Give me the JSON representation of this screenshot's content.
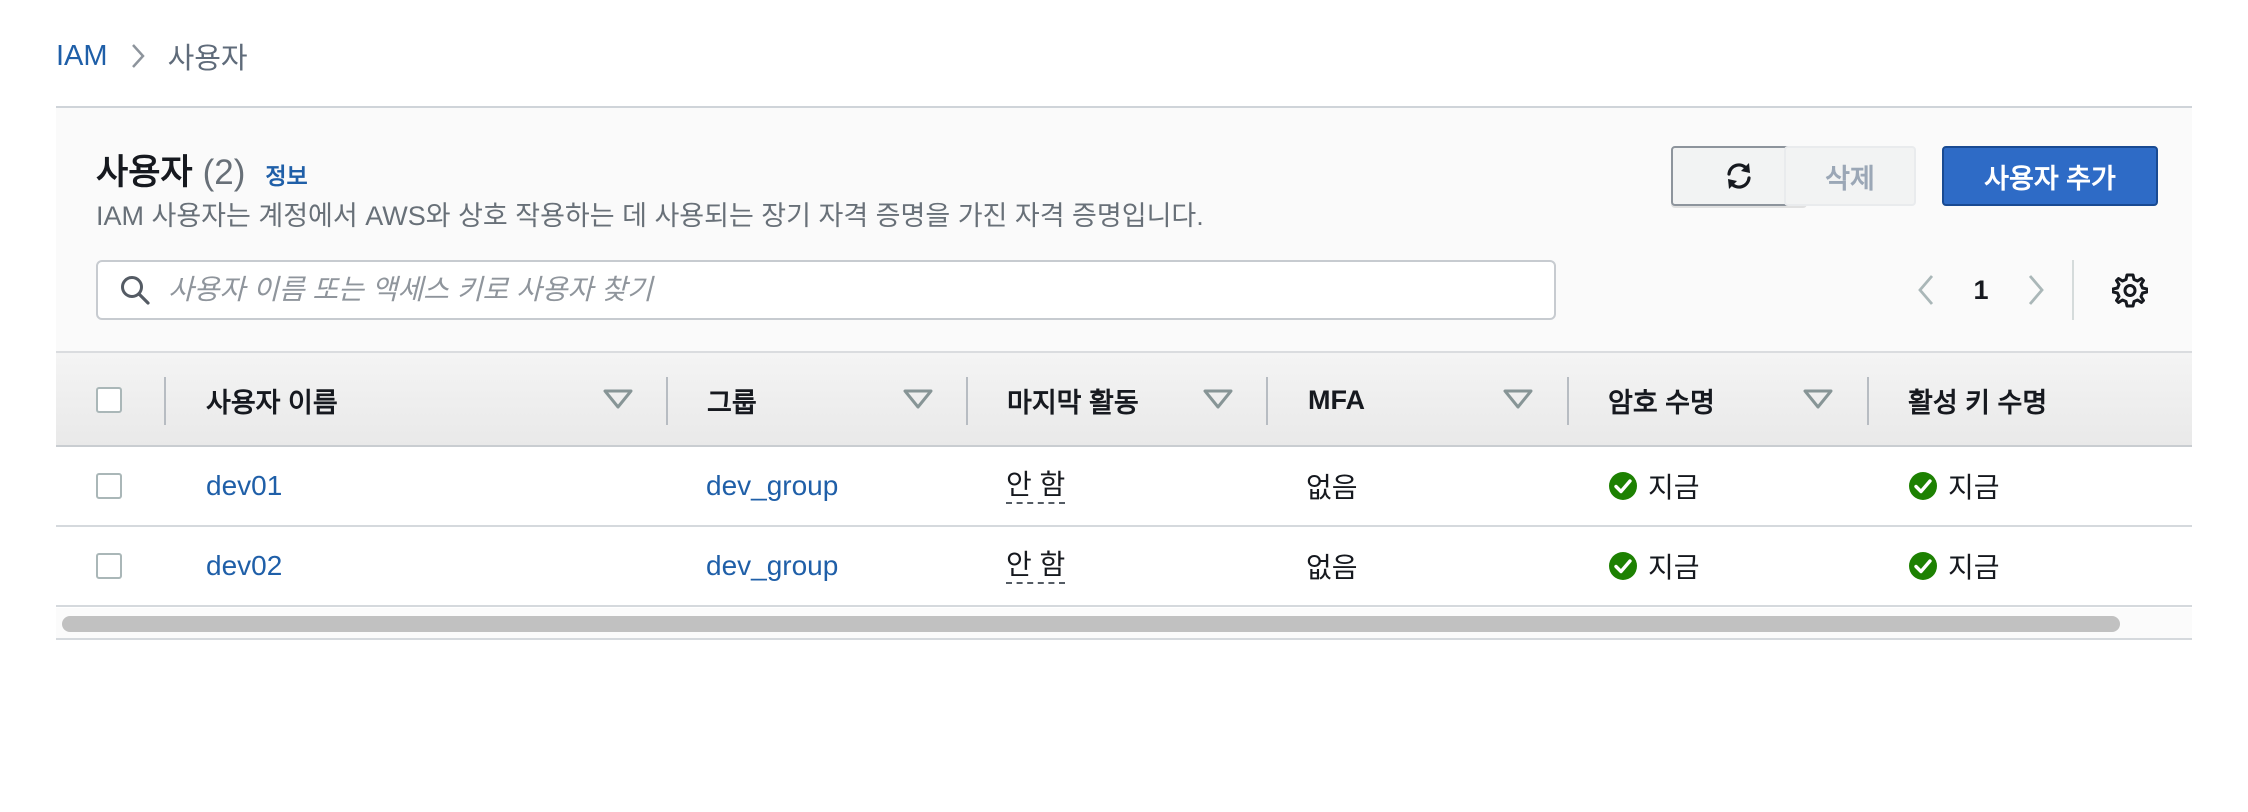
{
  "breadcrumb": {
    "root": "IAM",
    "current": "사용자"
  },
  "header": {
    "title": "사용자",
    "count": "(2)",
    "info_link": "정보",
    "description": "IAM 사용자는 계정에서 AWS와 상호 작용하는 데 사용되는 장기 자격 증명을 가진 자격 증명입니다."
  },
  "actions": {
    "refresh_icon": "refresh-icon",
    "delete_label": "삭제",
    "add_label": "사용자 추가"
  },
  "search": {
    "placeholder": "사용자 이름 또는 액세스 키로 사용자 찾기",
    "value": ""
  },
  "pagination": {
    "current_page": "1"
  },
  "table": {
    "columns": [
      {
        "label": "사용자 이름"
      },
      {
        "label": "그룹"
      },
      {
        "label": "마지막 활동"
      },
      {
        "label": "MFA"
      },
      {
        "label": "암호 수명"
      },
      {
        "label": "활성 키 수명"
      }
    ],
    "rows": [
      {
        "user_name": "dev01",
        "group": "dev_group",
        "last_activity": "안 함",
        "mfa": "없음",
        "password_age": "지금",
        "active_key_age": "지금"
      },
      {
        "user_name": "dev02",
        "group": "dev_group",
        "last_activity": "안 함",
        "mfa": "없음",
        "password_age": "지금",
        "active_key_age": "지금"
      }
    ]
  },
  "colors": {
    "link": "#1f5fa8",
    "primary_button": "#2e6bc6",
    "success": "#1d8102"
  }
}
